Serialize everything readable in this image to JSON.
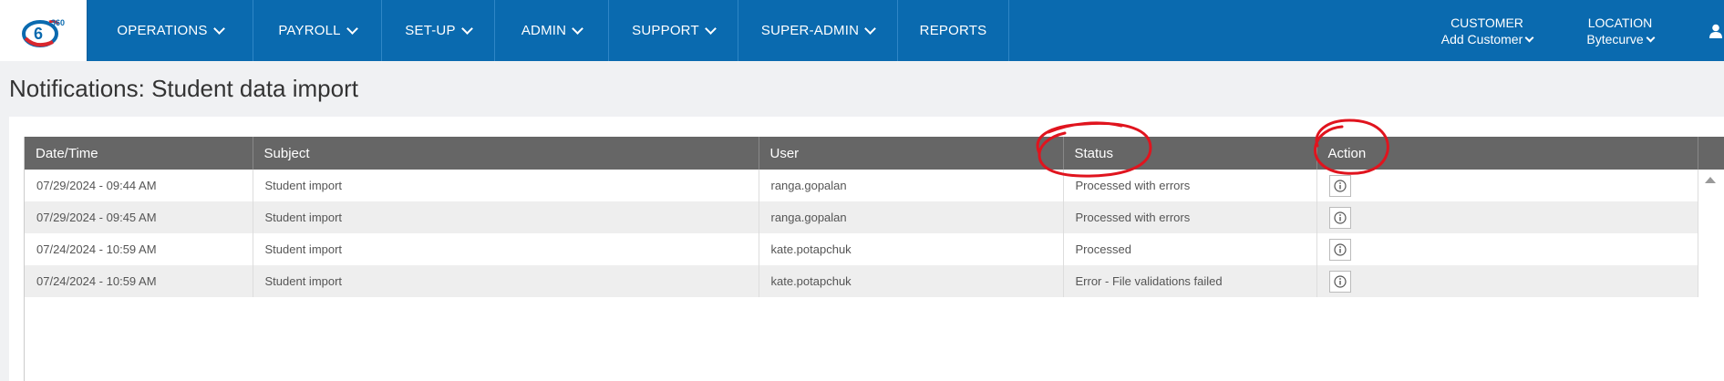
{
  "header": {
    "logo_text": "360",
    "nav": [
      {
        "label": "OPERATIONS",
        "dropdown": true
      },
      {
        "label": "PAYROLL",
        "dropdown": true
      },
      {
        "label": "SET-UP",
        "dropdown": true
      },
      {
        "label": "ADMIN",
        "dropdown": true
      },
      {
        "label": "SUPPORT",
        "dropdown": true
      },
      {
        "label": "SUPER-ADMIN",
        "dropdown": true
      },
      {
        "label": "REPORTS",
        "dropdown": false
      }
    ],
    "customer": {
      "label": "CUSTOMER",
      "value": "Add Customer"
    },
    "location": {
      "label": "LOCATION",
      "value": "Bytecurve"
    },
    "user_icon": "user-icon"
  },
  "page": {
    "title": "Notifications: Student data import"
  },
  "table": {
    "columns": [
      "Date/Time",
      "Subject",
      "User",
      "Status",
      "Action"
    ],
    "rows": [
      {
        "datetime": "07/29/2024 - 09:44 AM",
        "subject": "Student import",
        "user": "ranga.gopalan",
        "status": "Processed with errors",
        "action_icon": "info-icon"
      },
      {
        "datetime": "07/29/2024 - 09:45 AM",
        "subject": "Student import",
        "user": "ranga.gopalan",
        "status": "Processed with errors",
        "action_icon": "info-icon"
      },
      {
        "datetime": "07/24/2024 - 10:59 AM",
        "subject": "Student import",
        "user": "kate.potapchuk",
        "status": "Processed",
        "action_icon": "info-icon"
      },
      {
        "datetime": "07/24/2024 - 10:59 AM",
        "subject": "Student import",
        "user": "kate.potapchuk",
        "status": "Error - File validations failed",
        "action_icon": "info-icon"
      }
    ]
  },
  "colors": {
    "nav_bg": "#0a6aaf",
    "table_header_bg": "#666666",
    "annotation": "#e0141e"
  }
}
